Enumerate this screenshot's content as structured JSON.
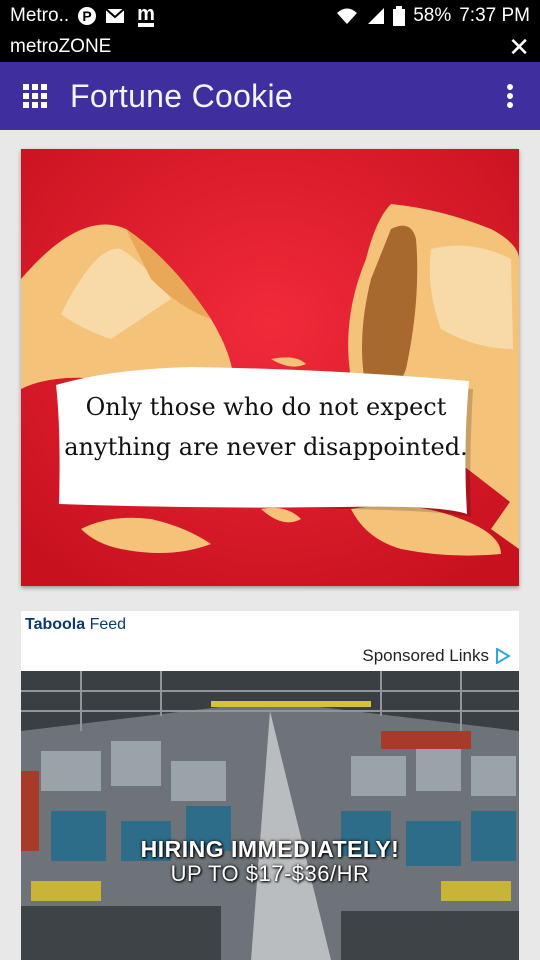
{
  "status_bar": {
    "carrier": "Metro..",
    "battery": "58%",
    "time": "7:37 PM",
    "icons": [
      "pinterest-icon",
      "mail-icon",
      "metrozone-icon",
      "wifi-icon",
      "signal-icon",
      "battery-icon"
    ]
  },
  "web_bar": {
    "title": "metroZONE",
    "close_label": "✕"
  },
  "app_bar": {
    "title": "Fortune Cookie",
    "color": "#3f2f9e"
  },
  "fortune": {
    "message": "Only those who do not expect anything are never disappointed.",
    "background_color": "#d8192b"
  },
  "feed": {
    "provider_brand": "Taboola",
    "provider_suffix": "Feed",
    "sponsored_label": "Sponsored Links",
    "ad_headline": "HIRING IMMEDIATELY!",
    "ad_subline": "UP TO $17-$36/HR"
  }
}
